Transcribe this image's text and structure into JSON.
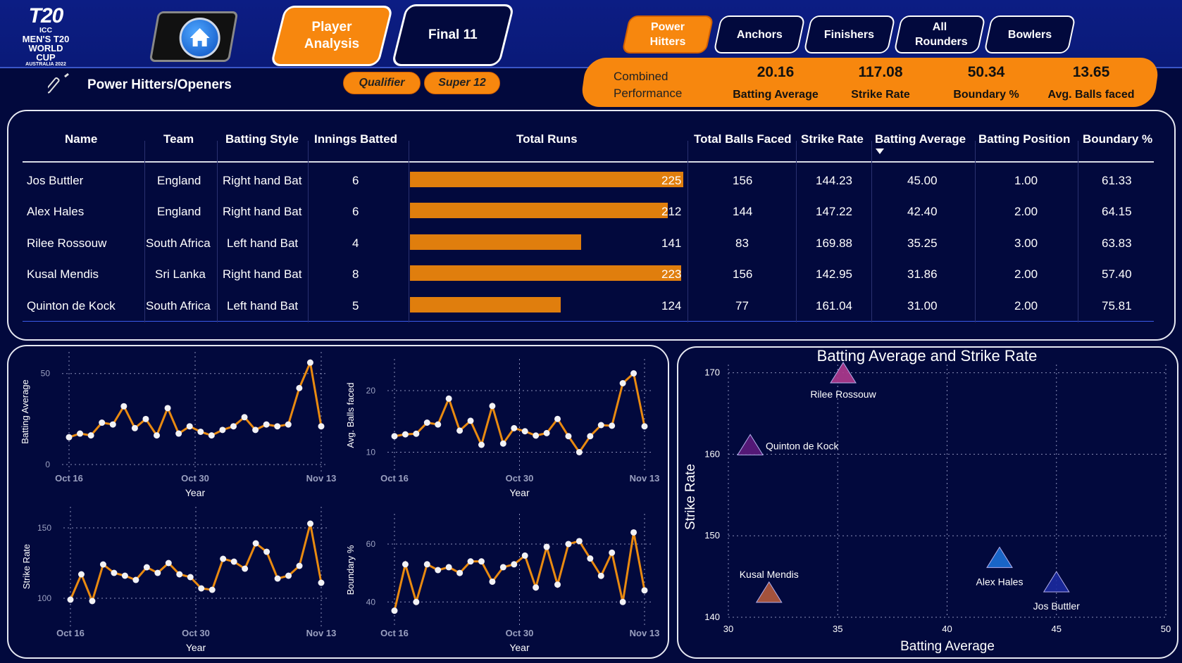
{
  "header": {
    "logo_line1": "T20",
    "logo_line2": "ICC",
    "logo_line3": "MEN'S T20",
    "logo_line4": "WORLD CUP",
    "logo_line5": "AUSTRALIA 2022",
    "nav_player_analysis": "Player Analysis",
    "nav_final11": "Final 11",
    "categories": [
      "Power Hitters",
      "Anchors",
      "Finishers",
      "All Rounders",
      "Bowlers"
    ],
    "stage_qualifier": "Qualifier",
    "stage_super12": "Super 12",
    "section_title": "Power Hitters/Openers"
  },
  "combined": {
    "label_line1": "Combined",
    "label_line2": "Performance",
    "kpis": [
      {
        "value": "20.16",
        "label": "Batting Average"
      },
      {
        "value": "117.08",
        "label": "Strike Rate"
      },
      {
        "value": "50.34",
        "label": "Boundary %"
      },
      {
        "value": "13.65",
        "label": "Avg. Balls faced"
      }
    ]
  },
  "table": {
    "columns": [
      "Name",
      "Team",
      "Batting Style",
      "Innings Batted",
      "Total Runs",
      "Total Balls Faced",
      "Strike Rate",
      "Batting Average",
      "Batting Position",
      "Boundary %"
    ],
    "bar_max": 225,
    "rows": [
      {
        "name": "Jos Buttler",
        "team": "England",
        "style": "Right hand Bat",
        "innings": "6",
        "runs": 225,
        "balls": "156",
        "sr": "144.23",
        "avg": "45.00",
        "pos": "1.00",
        "bnd": "61.33"
      },
      {
        "name": "Alex Hales",
        "team": "England",
        "style": "Right hand Bat",
        "innings": "6",
        "runs": 212,
        "balls": "144",
        "sr": "147.22",
        "avg": "42.40",
        "pos": "2.00",
        "bnd": "64.15"
      },
      {
        "name": "Rilee Rossouw",
        "team": "South Africa",
        "style": "Left hand Bat",
        "innings": "4",
        "runs": 141,
        "balls": "83",
        "sr": "169.88",
        "avg": "35.25",
        "pos": "3.00",
        "bnd": "63.83"
      },
      {
        "name": "Kusal Mendis",
        "team": "Sri Lanka",
        "style": "Right hand Bat",
        "innings": "8",
        "runs": 223,
        "balls": "156",
        "sr": "142.95",
        "avg": "31.86",
        "pos": "2.00",
        "bnd": "57.40"
      },
      {
        "name": "Quinton de Kock",
        "team": "South Africa",
        "style": "Left hand Bat",
        "innings": "5",
        "runs": 124,
        "balls": "77",
        "sr": "161.04",
        "avg": "31.00",
        "pos": "2.00",
        "bnd": "75.81"
      }
    ]
  },
  "chart_data": [
    {
      "type": "line",
      "ylabel": "Batting Average",
      "xlabel": "Year",
      "x_ticks": [
        "Oct 16",
        "Oct 30",
        "Nov 13"
      ],
      "y_ticks": [
        0,
        50
      ],
      "ylim": [
        0,
        58
      ],
      "values": [
        15,
        17,
        16,
        23,
        22,
        32,
        20,
        25,
        16,
        31,
        17,
        21,
        18,
        16,
        19,
        21,
        26,
        19,
        22,
        21,
        22,
        42,
        56,
        21
      ]
    },
    {
      "type": "line",
      "ylabel": "Avg. Balls faced",
      "xlabel": "Year",
      "x_ticks": [
        "Oct 16",
        "Oct 30",
        "Nov 13"
      ],
      "y_ticks": [
        10,
        20
      ],
      "ylim": [
        8,
        24
      ],
      "values": [
        12.6,
        12.9,
        13,
        14.8,
        14.5,
        18.7,
        13.5,
        15.1,
        11.2,
        17.5,
        11.4,
        13.9,
        13.4,
        12.7,
        13.1,
        15.4,
        12.6,
        10,
        12.6,
        14.4,
        14.3,
        21.2,
        22.8,
        14.2
      ]
    },
    {
      "type": "line",
      "ylabel": "Strike Rate",
      "xlabel": "Year",
      "x_ticks": [
        "Oct 16",
        "Oct 30",
        "Nov 13"
      ],
      "y_ticks": [
        100,
        150
      ],
      "ylim": [
        85,
        160
      ],
      "values": [
        99,
        117,
        98,
        124,
        118,
        116,
        113,
        122,
        118,
        125,
        117,
        115,
        107,
        106,
        128,
        126,
        121,
        139,
        133,
        114,
        116,
        123,
        153,
        111
      ]
    },
    {
      "type": "line",
      "ylabel": "Boundary %",
      "xlabel": "Year",
      "x_ticks": [
        "Oct 16",
        "Oct 30",
        "Nov 13"
      ],
      "y_ticks": [
        40,
        60
      ],
      "ylim": [
        34,
        68
      ],
      "values": [
        37,
        53,
        40,
        53,
        51,
        52,
        50,
        54,
        54,
        47,
        52,
        53,
        56,
        45,
        59,
        46,
        60,
        61,
        55,
        49,
        57,
        40,
        64,
        44
      ]
    },
    {
      "type": "scatter",
      "title": "Batting Average and Strike Rate",
      "xlabel": "Batting Average",
      "ylabel": "Strike Rate",
      "xlim": [
        30,
        50
      ],
      "ylim": [
        140,
        171
      ],
      "x_ticks": [
        30,
        35,
        40,
        45,
        50
      ],
      "y_ticks": [
        140,
        150,
        160,
        170
      ],
      "points": [
        {
          "label": "Rilee Rossouw",
          "x": 35.25,
          "y": 169.88,
          "color": "#b03a8e"
        },
        {
          "label": "Quinton de Kock",
          "x": 31.0,
          "y": 161.04,
          "color": "#5c1a7d"
        },
        {
          "label": "Alex Hales",
          "x": 42.4,
          "y": 147.22,
          "color": "#1c6fd6"
        },
        {
          "label": "Jos Buttler",
          "x": 45.0,
          "y": 144.23,
          "color": "#1b2aa0"
        },
        {
          "label": "Kusal Mendis",
          "x": 31.86,
          "y": 142.95,
          "color": "#b55a3c"
        }
      ]
    }
  ]
}
